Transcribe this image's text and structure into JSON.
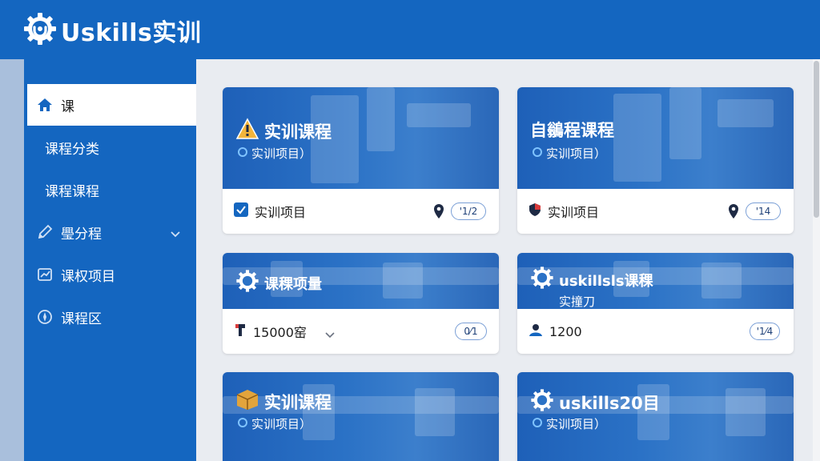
{
  "app": {
    "logo_text": "Uskills实训"
  },
  "sidebar": {
    "items": [
      {
        "label": "课",
        "icon": "home-icon",
        "active": true
      },
      {
        "label": "课程分类",
        "sub": true
      },
      {
        "label": "课程课程",
        "sub": true
      },
      {
        "label": "璺分程",
        "icon": "pencil-icon",
        "has_children": true
      },
      {
        "label": "课权项目",
        "icon": "chart-icon"
      },
      {
        "label": "课程区",
        "icon": "compass-icon"
      }
    ]
  },
  "cards": [
    {
      "title": "实训课程",
      "subtitle": "实训项目）",
      "title_icon": "warning-triangle-icon",
      "footer_label": "实训项目",
      "footer_icon": "checkbox-icon",
      "pill": "'1∕2"
    },
    {
      "title": "自鶲程课程",
      "subtitle": "实训项目）",
      "title_icon": "none",
      "footer_label": "实训项目",
      "footer_icon": "shield-icon",
      "pill": "'14"
    },
    {
      "title": "课稞项量",
      "subtitle": "",
      "title_icon": "gear-icon",
      "footer_label": "15000窑",
      "footer_icon": "hammer-icon",
      "footer_dropdown": true,
      "pill": "0⁄1"
    },
    {
      "title": "uskillsls课稞",
      "subtitle": "实撞刀",
      "title_icon": "gear-icon",
      "footer_label": "1200",
      "footer_icon": "user-icon",
      "pill": "'1⁄4"
    },
    {
      "title": "实训课程",
      "subtitle": "实训项目）",
      "title_icon": "box-icon",
      "footer_label": "",
      "pill": ""
    },
    {
      "title": "uskills20目",
      "subtitle": "实训项目）",
      "title_icon": "gear-icon",
      "footer_label": "",
      "pill": ""
    }
  ],
  "colors": {
    "primary": "#1466c0",
    "background": "#e9ecf1",
    "card": "#ffffff",
    "pill_border": "#7a9fd6"
  }
}
